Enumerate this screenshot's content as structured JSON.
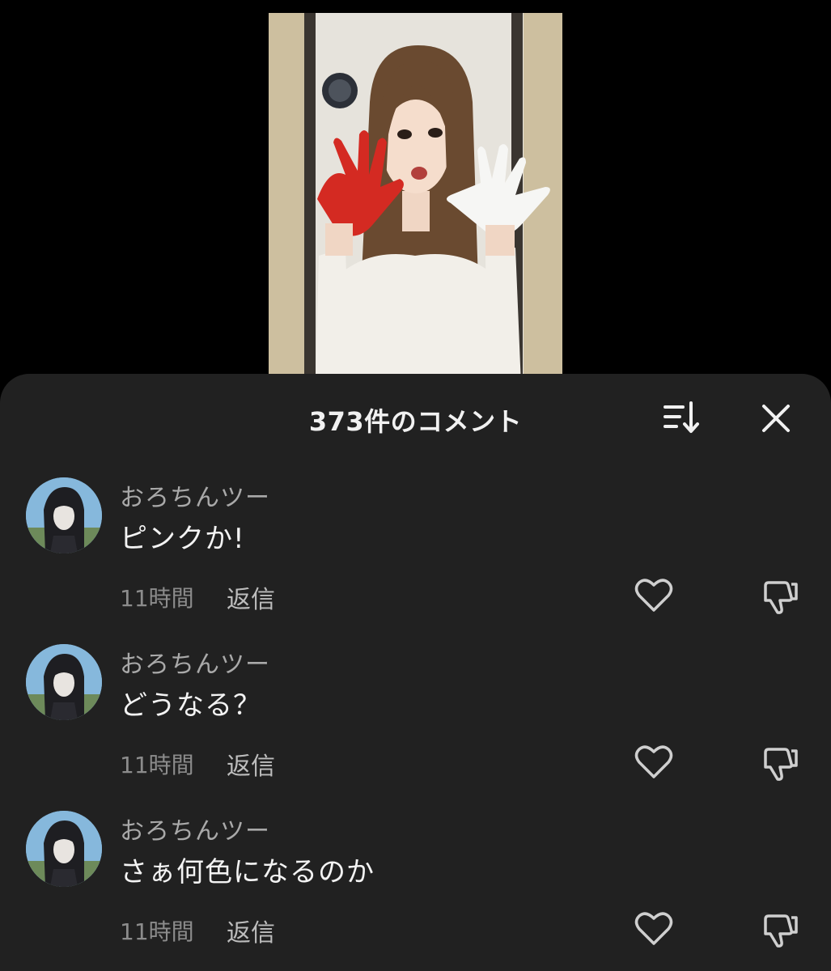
{
  "comments_panel": {
    "title": "373件のコメント",
    "sort_icon": "sort-icon",
    "close_icon": "close-icon"
  },
  "comments": [
    {
      "author": "おろちんツー",
      "text": "ピンクか!",
      "time": "11時間",
      "reply_label": "返信"
    },
    {
      "author": "おろちんツー",
      "text": "どうなる？",
      "time": "11時間",
      "reply_label": "返信"
    },
    {
      "author": "おろちんツー",
      "text": "さぁ何色になるのか",
      "time": "11時間",
      "reply_label": "返信"
    }
  ],
  "colors": {
    "sheet_background": "#212121",
    "page_background": "#000000",
    "author_text": "#a9a9a9",
    "comment_text": "#f3f3f3"
  }
}
